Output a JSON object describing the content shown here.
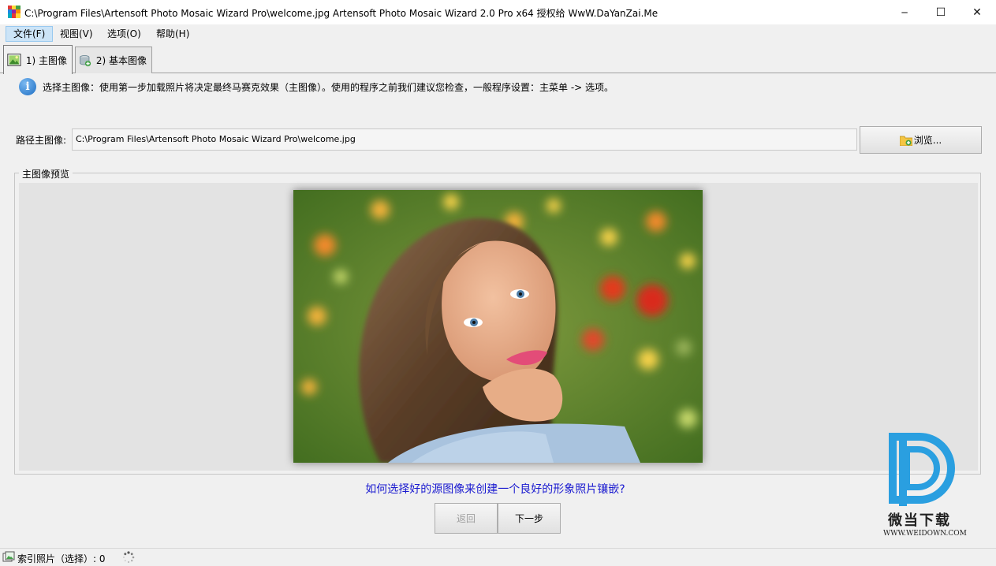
{
  "window": {
    "title": "C:\\Program Files\\Artensoft Photo Mosaic Wizard Pro\\welcome.jpg Artensoft Photo Mosaic Wizard 2.0 Pro x64  授权给 WwW.DaYanZai.Me",
    "minimize_glyph": "─",
    "maximize_glyph": "☐",
    "close_glyph": "✕"
  },
  "menu": {
    "file": "文件(F)",
    "view": "视图(V)",
    "options": "选项(O)",
    "help": "帮助(H)"
  },
  "tabs": [
    {
      "label": "1) 主图像",
      "active": true
    },
    {
      "label": "2) 基本图像",
      "active": false
    }
  ],
  "info": {
    "icon_glyph": "i",
    "text": "选择主图像：使用第一步加载照片将决定最终马赛克效果（主图像）。使用的程序之前我们建议您检查，一般程序设置：主菜单 -> 选项。"
  },
  "path": {
    "label": "路径主图像:",
    "value": "C:\\Program Files\\Artensoft Photo Mosaic Wizard Pro\\welcome.jpg",
    "browse_label": "浏览..."
  },
  "preview": {
    "legend": "主图像预览"
  },
  "help_link": "如何选择好的源图像来创建一个良好的形象照片镶嵌?",
  "buttons": {
    "back": "返回",
    "next": "下一步"
  },
  "watermark": {
    "brand": "微当下载",
    "url": "WWW.WEIDOWN.COM"
  },
  "status": {
    "text": "索引照片（选择）: 0"
  },
  "colors": {
    "link": "#1a1ad0",
    "menu_active": "#cce4f7",
    "watermark_blue": "#2a9fe0"
  }
}
